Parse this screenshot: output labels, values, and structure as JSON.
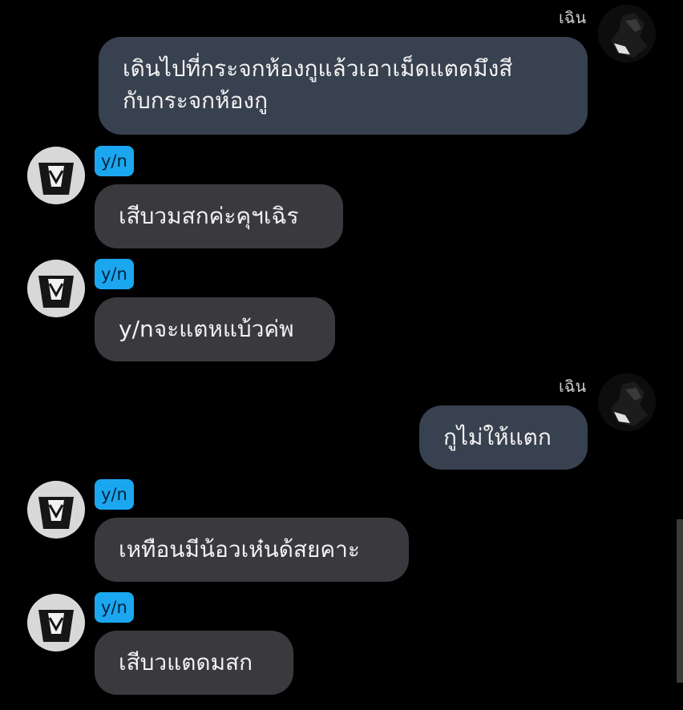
{
  "messages": [
    {
      "direction": "outgoing",
      "sender": "เฉิน",
      "text": "เดินไปที่กระจกห้องกูแล้วเอาเม็ดแตดมึงสี\nกับกระจกห้องกู"
    },
    {
      "direction": "incoming",
      "sender": "y/n",
      "text": "เสีบวมสกค่ะคุฯเฉิร"
    },
    {
      "direction": "incoming",
      "sender": "y/n",
      "text": "y/nจะแตหแบ้วค่พ"
    },
    {
      "direction": "outgoing",
      "sender": "เฉิน",
      "text": "กูไม่ให้แตก"
    },
    {
      "direction": "incoming",
      "sender": "y/n",
      "text": "เหทือนมีน้อวเห๋นด้สยคาะ"
    },
    {
      "direction": "incoming",
      "sender": "y/n",
      "text": "เสีบวแตดมสก"
    }
  ],
  "colors": {
    "background": "#000000",
    "incoming_bubble": "#3a3a3e",
    "outgoing_bubble": "#38414f",
    "tag": "#1ba7f0"
  }
}
